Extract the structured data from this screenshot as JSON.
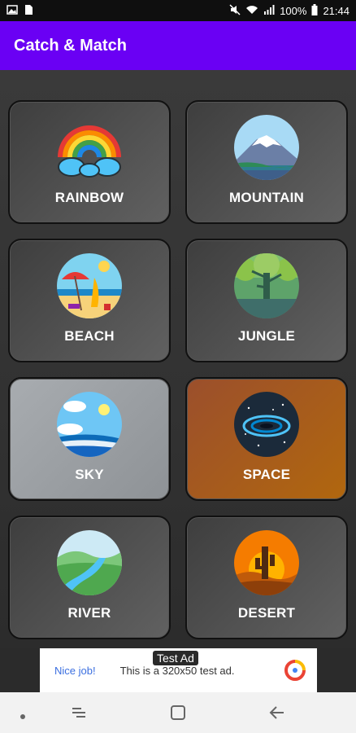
{
  "status_bar": {
    "left_icons": [
      "image-icon",
      "sim-card-icon"
    ],
    "battery": "100%",
    "time": "21:44",
    "right_icons": [
      "mute-icon",
      "wifi-icon",
      "signal-icon",
      "battery-icon"
    ]
  },
  "app": {
    "title": "Catch & Match",
    "accent_color": "#6a00f4"
  },
  "categories": [
    {
      "label": "RAINBOW",
      "icon": "rainbow-icon"
    },
    {
      "label": "MOUNTAIN",
      "icon": "mountain-icon"
    },
    {
      "label": "BEACH",
      "icon": "beach-icon"
    },
    {
      "label": "JUNGLE",
      "icon": "jungle-icon"
    },
    {
      "label": "SKY",
      "icon": "sky-icon"
    },
    {
      "label": "SPACE",
      "icon": "space-icon"
    },
    {
      "label": "RIVER",
      "icon": "river-icon"
    },
    {
      "label": "DESERT",
      "icon": "desert-icon"
    }
  ],
  "ad": {
    "tag": "Test Ad",
    "headline": "Nice job!",
    "body": "This is a 320x50 test ad."
  },
  "nav_bar": {
    "items": [
      "dot-icon",
      "recents-icon",
      "home-icon",
      "back-icon"
    ]
  }
}
